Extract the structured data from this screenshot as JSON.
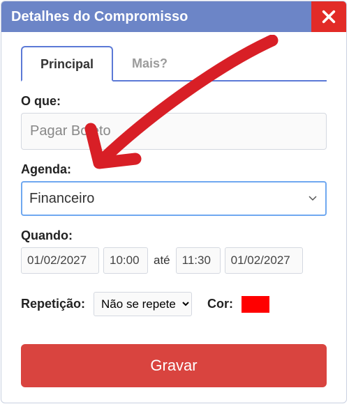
{
  "header": {
    "title": "Detalhes do Compromisso"
  },
  "tabs": {
    "principal": "Principal",
    "mais": "Mais?"
  },
  "fields": {
    "what_label": "O que:",
    "what_value": "Pagar Boleto",
    "agenda_label": "Agenda:",
    "agenda_value": "Financeiro",
    "when_label": "Quando:",
    "date_start": "01/02/2027",
    "time_start": "10:00",
    "until_text": "até",
    "time_end": "11:30",
    "date_end": "01/02/2027",
    "repeat_label": "Repetição:",
    "repeat_value": "Não se repete",
    "color_label": "Cor:",
    "color_value": "#ff0000"
  },
  "buttons": {
    "save": "Gravar"
  }
}
